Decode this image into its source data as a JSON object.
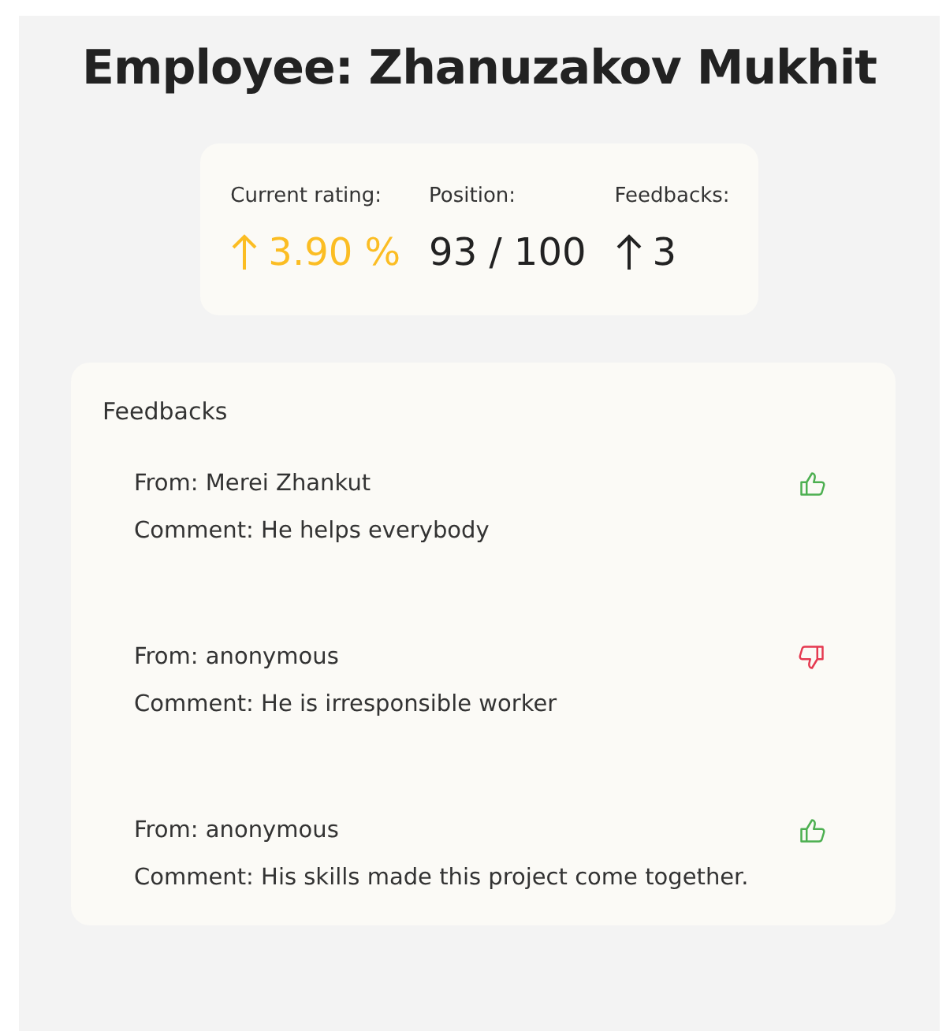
{
  "title": "Employee: Zhanuzakov Mukhit",
  "stats": [
    {
      "label": "Current rating:",
      "value": "3.90 %",
      "rising": true,
      "highlighted": true
    },
    {
      "label": "Position:",
      "value": "93 / 100",
      "rising": false,
      "highlighted": false
    },
    {
      "label": "Feedbacks:",
      "value": "3",
      "rising": true,
      "highlighted": false
    }
  ],
  "feedbacks": {
    "heading": "Feedbacks",
    "items": [
      {
        "from": "From: Merei Zhankut",
        "comment": "Comment: He helps everybody",
        "kind": "up"
      },
      {
        "from": "From: anonymous",
        "comment": "Comment: He is irresponsible worker",
        "kind": "down"
      },
      {
        "from": "From: anonymous",
        "comment": "Comment: His skills made this project come together.",
        "kind": "up"
      }
    ]
  }
}
